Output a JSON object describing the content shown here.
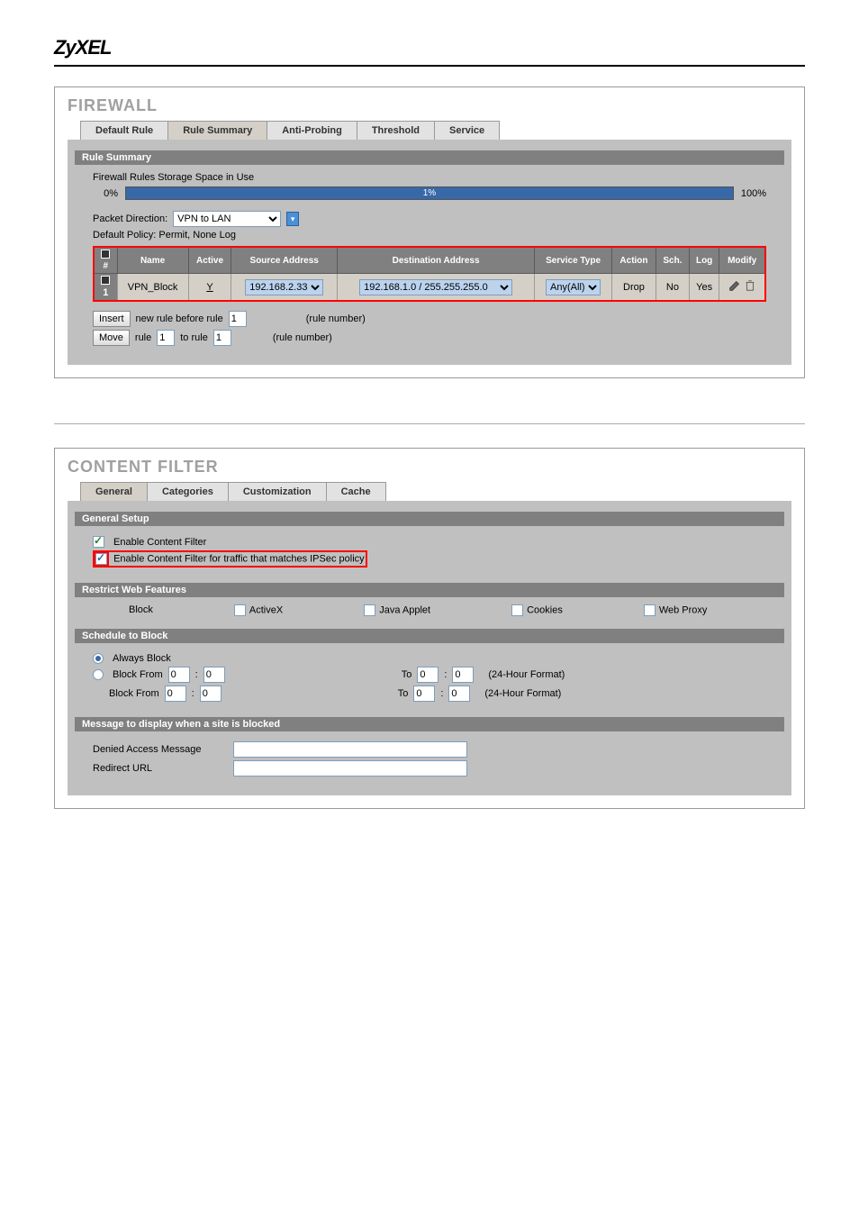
{
  "brand": "ZyXEL",
  "firewall": {
    "title": "FIREWALL",
    "tabs": [
      "Default Rule",
      "Rule Summary",
      "Anti-Probing",
      "Threshold",
      "Service"
    ],
    "active_tab": "Rule Summary",
    "storage_label": "Firewall Rules Storage Space in Use",
    "progress_left": "0%",
    "progress_center": "1%",
    "progress_right": "100%",
    "packet_direction_label": "Packet Direction:",
    "packet_direction_value": "VPN to LAN",
    "default_policy": "Default Policy: Permit, None Log",
    "table": {
      "headers": [
        "#",
        "Name",
        "Active",
        "Source Address",
        "Destination Address",
        "Service Type",
        "Action",
        "Sch.",
        "Log",
        "Modify"
      ],
      "row": {
        "num": "1",
        "name": "VPN_Block",
        "active": "Y",
        "source": "192.168.2.33",
        "dest": "192.168.1.0 / 255.255.255.0",
        "service": "Any(All)",
        "action": "Drop",
        "sch": "No",
        "log": "Yes"
      }
    },
    "insert_btn": "Insert",
    "insert_text1": "new rule before rule",
    "insert_rule_value": "1",
    "insert_text2": "(rule number)",
    "move_btn": "Move",
    "move_text1": "rule",
    "move_rule_value": "1",
    "move_text2": "to rule",
    "move_to_value": "1",
    "move_text3": "(rule number)"
  },
  "content_filter": {
    "title": "CONTENT FILTER",
    "tabs": [
      "General",
      "Categories",
      "Customization",
      "Cache"
    ],
    "active_tab": "General",
    "general_setup_header": "General Setup",
    "enable_cf": "Enable Content Filter",
    "enable_cf_ipsec": "Enable Content Filter for traffic that matches IPSec policy",
    "restrict_header": "Restrict Web Features",
    "block_label": "Block",
    "features": [
      "ActiveX",
      "Java Applet",
      "Cookies",
      "Web Proxy"
    ],
    "schedule_header": "Schedule to Block",
    "always_block": "Always Block",
    "block_from": "Block From",
    "to_label": "To",
    "time_h": "0",
    "time_m": "0",
    "format_label": "(24-Hour Format)",
    "message_header": "Message to display when a site is blocked",
    "denied_label": "Denied Access Message",
    "redirect_label": "Redirect URL"
  }
}
